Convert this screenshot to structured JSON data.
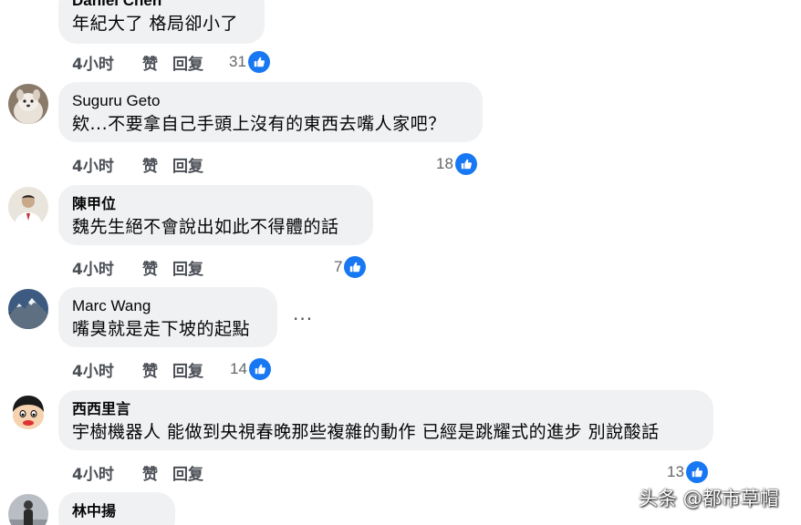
{
  "comments": [
    {
      "author": "Daniel Chen",
      "text": "年紀大了 格局卻小了",
      "time": "4小时",
      "like_label": "赞",
      "reply_label": "回复",
      "reactions": "31",
      "avatar_icon": "none"
    },
    {
      "author": "Suguru Geto",
      "text": "欸...不要拿自己手頭上沒有的東西去嘴人家吧？",
      "time": "4小时",
      "like_label": "赞",
      "reply_label": "回复",
      "reactions": "18",
      "avatar_icon": "dog-avatar-icon"
    },
    {
      "author": "陳甲位",
      "text": "魏先生絕不會說出如此不得體的話",
      "time": "4小时",
      "like_label": "赞",
      "reply_label": "回复",
      "reactions": "7",
      "avatar_icon": "person-avatar-icon"
    },
    {
      "author": "Marc Wang",
      "text": "嘴臭就是走下坡的起點",
      "time": "4小时",
      "like_label": "赞",
      "reply_label": "回复",
      "reactions": "14",
      "avatar_icon": "mountain-avatar-icon"
    },
    {
      "author": "西西里言",
      "text": "宇樹機器人 能做到央視春晚那些複雜的動作 已經是跳耀式的進步 別說酸話",
      "time": "4小时",
      "like_label": "赞",
      "reply_label": "回复",
      "reactions": "13",
      "avatar_icon": "cartoon-avatar-icon"
    },
    {
      "author": "林中揚",
      "avatar_icon": "person-standing-avatar-icon"
    }
  ],
  "more_options": "···",
  "watermark": "头条 @都市草帽",
  "colors": {
    "like_blue": "#1877f2",
    "bubble": "#eff1f3",
    "action_gray": "#4b4f56"
  }
}
